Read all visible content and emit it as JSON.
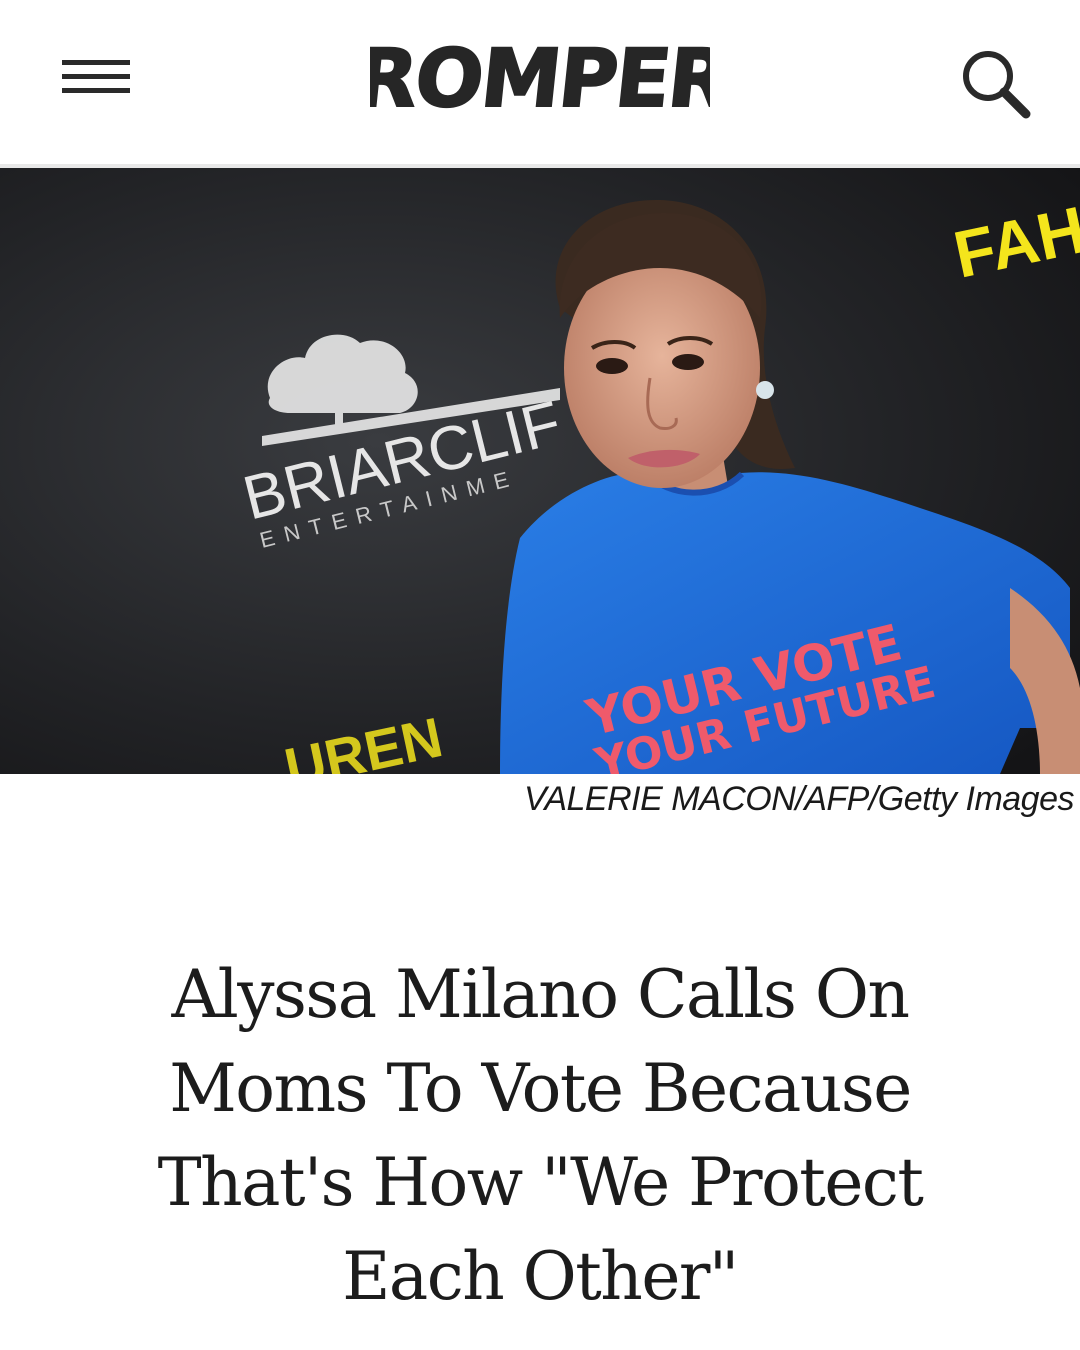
{
  "header": {
    "logo_text": "ROMPER",
    "menu_icon": "hamburger-menu-icon",
    "search_icon": "search-icon"
  },
  "hero": {
    "image_subject": "woman on red carpet",
    "backdrop_texts": [
      "BRIARCLIF",
      "ENTERTAINME",
      "FAH",
      "UREN"
    ],
    "shirt_text_line1": "YOUR VOTE",
    "shirt_text_line2": "YOUR FUTURE",
    "photo_credit": "VALERIE MACON/AFP/Getty Images"
  },
  "article": {
    "headline": "Alyssa Milano Calls On Moms To Vote Because That's How \"We Protect Each Other\""
  },
  "colors": {
    "text_dark": "#1c1c1c",
    "header_border": "#e8e8e8",
    "backdrop": "#1c1d1f",
    "shirt_blue": "#1f6fd6",
    "shirt_text": "#ef5a6b",
    "accent_yellow": "#f4e51c"
  }
}
